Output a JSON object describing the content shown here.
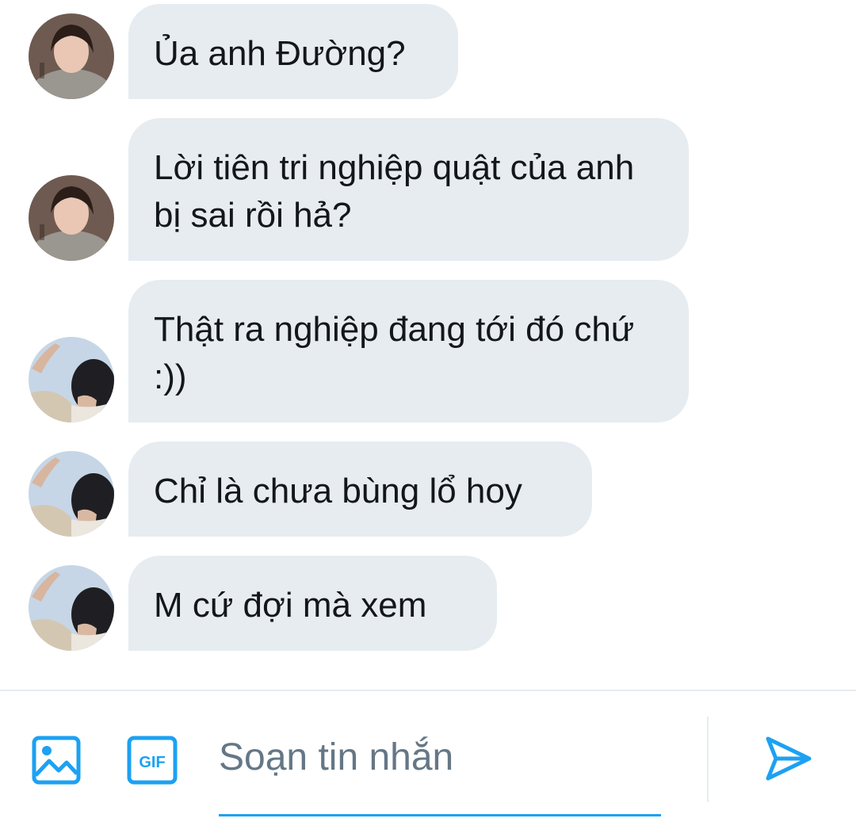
{
  "messages": [
    {
      "sender": "user-a",
      "text": "Ủa anh Đường?"
    },
    {
      "sender": "user-a",
      "text": "Lời tiên tri nghiệp quật của anh bị sai rồi hả?"
    },
    {
      "sender": "user-b",
      "text": "Thật ra nghiệp đang tới đó chứ :))"
    },
    {
      "sender": "user-b",
      "text": "Chỉ là chưa bùng lổ hoy"
    },
    {
      "sender": "user-b",
      "text": "M cứ đợi mà xem"
    }
  ],
  "composer": {
    "placeholder": "Soạn tin nhắn",
    "gif_label": "GIF",
    "icons": {
      "image": "image-icon",
      "gif": "gif-icon",
      "send": "send-icon"
    }
  },
  "colors": {
    "bubble": "#e6ecf0",
    "accent": "#1da1f2",
    "text": "#14171a",
    "placeholder": "#657786"
  }
}
